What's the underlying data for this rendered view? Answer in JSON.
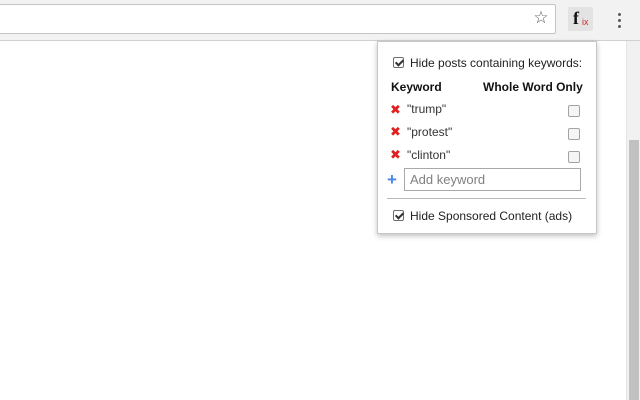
{
  "browser": {
    "star_icon": "☆",
    "extension": {
      "name": "fix-extension-icon",
      "glyph_f": "f",
      "glyph_x": "ix"
    },
    "menu_icon": "vertical-dots"
  },
  "popup": {
    "hide_keywords": {
      "label": "Hide posts containing keywords:",
      "checked": true
    },
    "columns": {
      "keyword": "Keyword",
      "whole_word": "Whole Word Only"
    },
    "keywords": [
      {
        "text": "\"trump\"",
        "whole_word": false
      },
      {
        "text": "\"protest\"",
        "whole_word": false
      },
      {
        "text": "\"clinton\"",
        "whole_word": false
      }
    ],
    "remove_glyph": "✖",
    "add_glyph": "+",
    "add_input": {
      "placeholder": "Add keyword",
      "value": ""
    },
    "hide_sponsored": {
      "label": "Hide Sponsored Content (ads)",
      "checked": true
    }
  }
}
